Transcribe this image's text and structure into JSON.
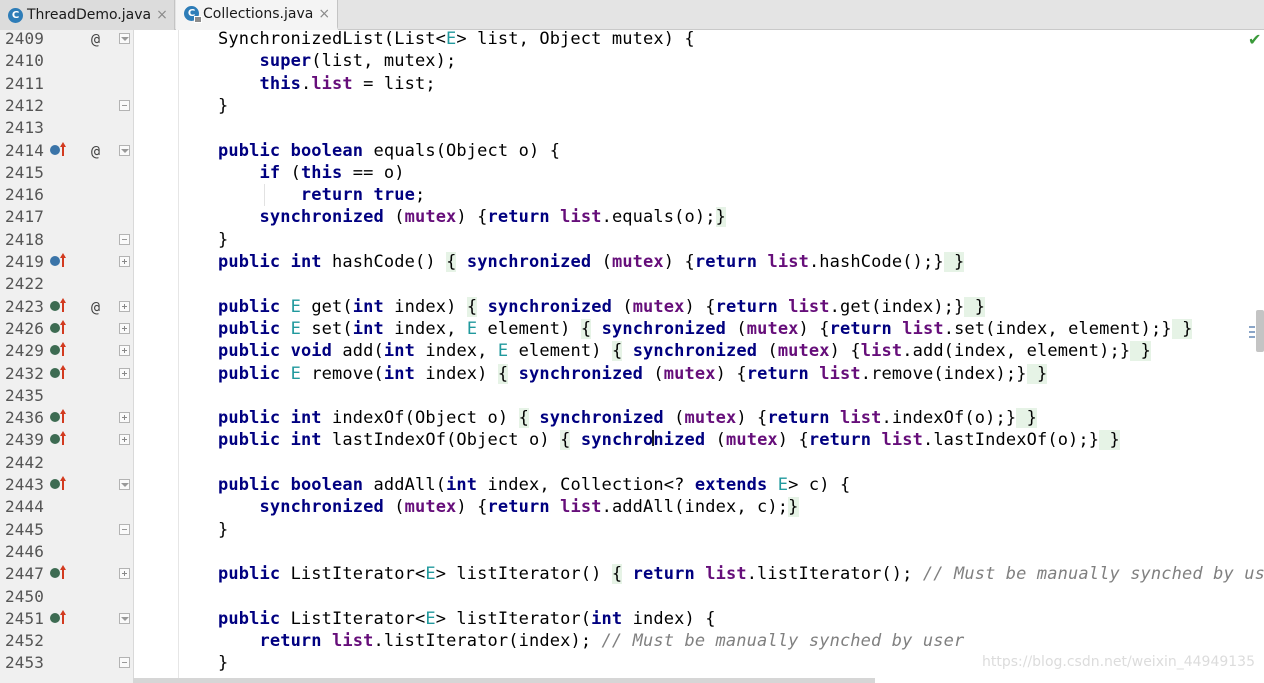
{
  "tabs": [
    {
      "label": "ThreadDemo.java",
      "icon": "java-class-icon",
      "icon_letter": "C",
      "active": false
    },
    {
      "label": "Collections.java",
      "icon": "java-class-locked-icon",
      "icon_letter": "C",
      "active": true
    }
  ],
  "close_glyph": "×",
  "watermark": "https://blog.csdn.net/weixin_44949135",
  "lines": [
    {
      "n": "2409",
      "at": "@",
      "fold": "open",
      "code": "SynchronizedList(List<E> list, Object mutex) {"
    },
    {
      "n": "2410",
      "code": "    super(list, mutex);"
    },
    {
      "n": "2411",
      "code": "    this.list = list;"
    },
    {
      "n": "2412",
      "fold": "end",
      "code": "}"
    },
    {
      "n": "2413",
      "code": ""
    },
    {
      "n": "2414",
      "marker": "override",
      "at": "@",
      "fold": "open",
      "code": "public boolean equals(Object o) {"
    },
    {
      "n": "2415",
      "code": "    if (this == o)"
    },
    {
      "n": "2416",
      "code": "        return true;"
    },
    {
      "n": "2417",
      "code": "    synchronized (mutex) {return list.equals(o);}"
    },
    {
      "n": "2418",
      "fold": "end",
      "code": "}"
    },
    {
      "n": "2419",
      "marker": "override",
      "fold": "plus",
      "code": "public int hashCode() { synchronized (mutex) {return list.hashCode();} }"
    },
    {
      "n": "2422",
      "code": ""
    },
    {
      "n": "2423",
      "marker": "implements",
      "at": "@",
      "fold": "plus",
      "code": "public E get(int index) { synchronized (mutex) {return list.get(index);} }"
    },
    {
      "n": "2426",
      "marker": "implements",
      "fold": "plus",
      "code": "public E set(int index, E element) { synchronized (mutex) {return list.set(index, element);} }"
    },
    {
      "n": "2429",
      "marker": "implements",
      "fold": "plus",
      "code": "public void add(int index, E element) { synchronized (mutex) {list.add(index, element);} }"
    },
    {
      "n": "2432",
      "marker": "implements",
      "fold": "plus",
      "code": "public E remove(int index) { synchronized (mutex) {return list.remove(index);} }"
    },
    {
      "n": "2435",
      "code": ""
    },
    {
      "n": "2436",
      "marker": "implements",
      "fold": "plus",
      "code": "public int indexOf(Object o) { synchronized (mutex) {return list.indexOf(o);} }"
    },
    {
      "n": "2439",
      "marker": "implements",
      "fold": "plus",
      "code": "public int lastIndexOf(Object o) { synchronized (mutex) {return list.lastIndexOf(o);} }"
    },
    {
      "n": "2442",
      "code": ""
    },
    {
      "n": "2443",
      "marker": "implements",
      "fold": "open",
      "code": "public boolean addAll(int index, Collection<? extends E> c) {"
    },
    {
      "n": "2444",
      "code": "    synchronized (mutex) {return list.addAll(index, c);}"
    },
    {
      "n": "2445",
      "fold": "end",
      "code": "}"
    },
    {
      "n": "2446",
      "code": ""
    },
    {
      "n": "2447",
      "marker": "implements",
      "fold": "plus",
      "code": "public ListIterator<E> listIterator() { return list.listIterator(); // Must be manually synched by user"
    },
    {
      "n": "2450",
      "code": ""
    },
    {
      "n": "2451",
      "marker": "implements",
      "fold": "open",
      "code": "public ListIterator<E> listIterator(int index) {"
    },
    {
      "n": "2452",
      "code": "    return list.listIterator(index); // Must be manually synched by user"
    },
    {
      "n": "2453",
      "fold": "end",
      "code": "}"
    }
  ]
}
